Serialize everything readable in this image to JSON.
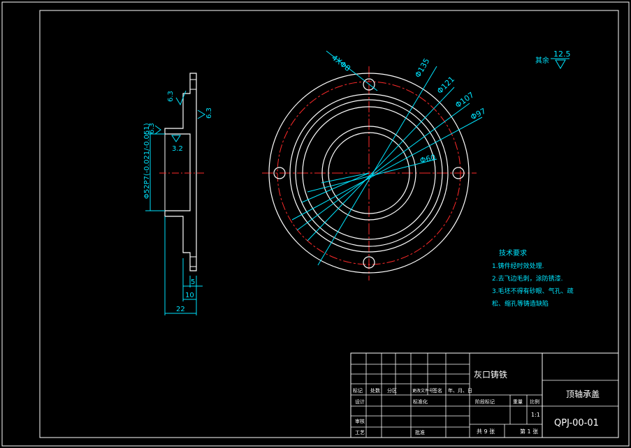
{
  "drawing": {
    "colors": {
      "background": "#000000",
      "outline": "#ffffff",
      "dimension": "#00e5ff",
      "centerline": "#ff2a2a"
    }
  },
  "front_view": {
    "hole_label": "4XΦ8",
    "diameters": [
      "Φ135",
      "Φ121",
      "Φ107",
      "Φ97",
      "Φ60"
    ]
  },
  "section_view": {
    "bore_label": "Φ52P7(-0.021/-0.051)",
    "bore_tol_upper": "-0.021",
    "bore_tol_lower": "-0.051",
    "roughness": [
      "6.3",
      "6.3",
      "6.3",
      "3.2"
    ],
    "dims": [
      "5",
      "10",
      "22"
    ]
  },
  "roughness_note": {
    "label": "其余",
    "value": "12.5"
  },
  "notes": {
    "title": "技术要求",
    "items": [
      "1.铸件经时效处理.",
      "2.去飞边毛刺，涂防锈漆.",
      "3.毛坯不得有砂眼、气孔、疏",
      "松、缩孔等铸造缺陷"
    ]
  },
  "title_block": {
    "material": "灰口铸铁",
    "part_name": "顶轴承盖",
    "drawing_no": "QPJ-00-01",
    "headers": [
      "标记",
      "处数",
      "分区",
      "更改文件号",
      "签名",
      "年、月、日"
    ],
    "row_labels": [
      "设计",
      "标准化",
      "审核",
      "工艺",
      "批准"
    ],
    "stage_headers": [
      "阶段标记",
      "重量",
      "比例"
    ],
    "scale": "1:1",
    "sheets_total": "共 9 张",
    "sheet_no": "第 1 张"
  }
}
